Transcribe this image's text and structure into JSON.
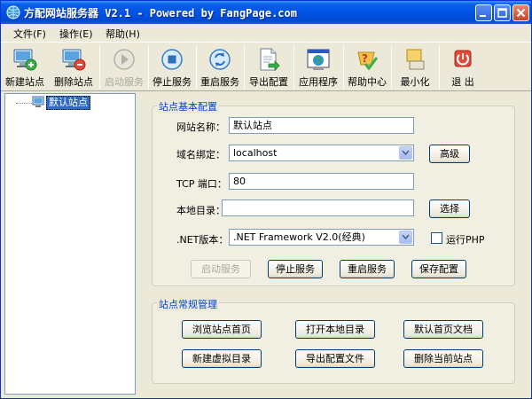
{
  "window": {
    "title": "方配网站服务器 V2.1 - Powered by FangPage.com"
  },
  "menu": [
    {
      "label": "文件(F)"
    },
    {
      "label": "操作(E)"
    },
    {
      "label": "帮助(H)"
    }
  ],
  "toolbar": [
    {
      "label": "新建站点",
      "icon": "new-site-icon",
      "enabled": true
    },
    {
      "label": "删除站点",
      "icon": "delete-site-icon",
      "enabled": true
    },
    {
      "label": "启动服务",
      "icon": "play-icon",
      "enabled": false
    },
    {
      "label": "停止服务",
      "icon": "stop-icon",
      "enabled": true
    },
    {
      "label": "重启服务",
      "icon": "restart-icon",
      "enabled": true
    },
    {
      "label": "导出配置",
      "icon": "export-icon",
      "enabled": true
    },
    {
      "label": "应用程序",
      "icon": "application-icon",
      "enabled": true
    },
    {
      "label": "帮助中心",
      "icon": "help-icon",
      "enabled": true
    },
    {
      "label": "最小化",
      "icon": "minimize-icon",
      "enabled": true
    },
    {
      "label": "退 出",
      "icon": "exit-icon",
      "enabled": true
    }
  ],
  "tree": {
    "items": [
      {
        "label": "默认站点",
        "selected": true
      }
    ]
  },
  "basic_config": {
    "title": "站点基本配置",
    "site_name_label": "网站名称：",
    "site_name_value": "默认站点",
    "domain_label": "域名绑定：",
    "domain_value": "localhost",
    "advanced_button": "高级",
    "port_label": "TCP 端口：",
    "port_value": "80",
    "local_dir_label": "本地目录：",
    "local_dir_value": "",
    "browse_button": "选择",
    "dotnet_label": ".NET版本：",
    "dotnet_value": ".NET Framework V2.0(经典)",
    "php_label": "运行PHP",
    "php_checked": false,
    "start_button": "启动服务",
    "stop_button": "停止服务",
    "restart_button": "重启服务",
    "save_button": "保存配置"
  },
  "management": {
    "title": "站点常规管理",
    "buttons": [
      {
        "label": "浏览站点首页"
      },
      {
        "label": "打开本地目录"
      },
      {
        "label": "默认首页文档"
      },
      {
        "label": "新建虚拟目录"
      },
      {
        "label": "导出配置文件"
      },
      {
        "label": "删除当前站点"
      }
    ]
  },
  "colors": {
    "titlebar": "#0054e3",
    "group_title": "#0046d5",
    "selection": "#316ac5"
  }
}
